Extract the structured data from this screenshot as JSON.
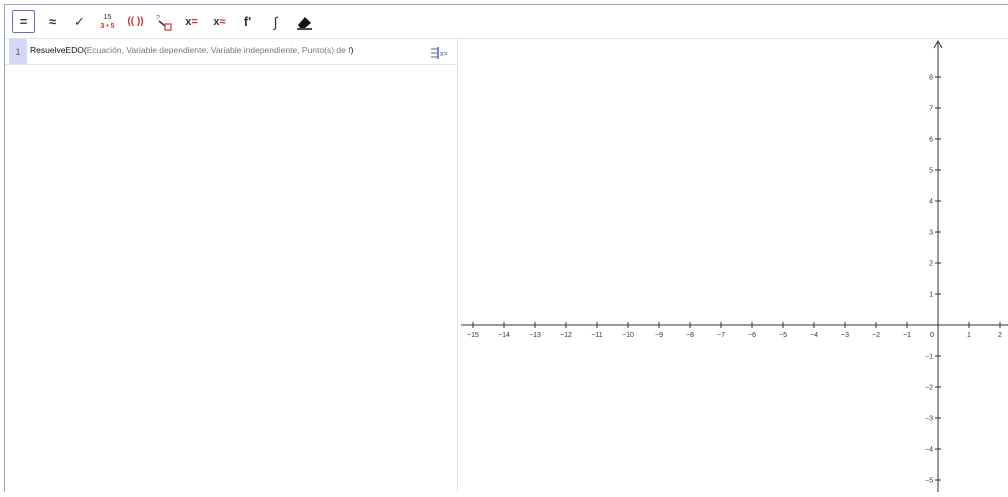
{
  "toolbar": {
    "tools": [
      {
        "name": "evaluate-tool",
        "label": "=",
        "active": true
      },
      {
        "name": "numeric-tool",
        "label": "≈"
      },
      {
        "name": "keep-input-tool",
        "label": "✓"
      },
      {
        "name": "factor-tool",
        "top": "15",
        "bottom": "3 • 5"
      },
      {
        "name": "expand-tool",
        "label": "(( ))"
      },
      {
        "name": "substitute-tool",
        "label": "?"
      },
      {
        "name": "solve-tool",
        "label": "x="
      },
      {
        "name": "solve-numeric-tool",
        "label": "x≈"
      },
      {
        "name": "derivative-tool",
        "label": "f'"
      },
      {
        "name": "integral-tool",
        "label": "∫"
      },
      {
        "name": "delete-tool",
        "label": ""
      }
    ]
  },
  "algebra": {
    "row_number": "1",
    "command_name": "ResuelveEDO(",
    "args": [
      "Ecuación",
      "Variable dependiente",
      "Variable independiente",
      "Punto(s) de f"
    ],
    "separator": ", ",
    "close": ")",
    "menu_icon": "x="
  },
  "graph": {
    "x_ticks": [
      "−15",
      "−14",
      "−13",
      "−12",
      "−11",
      "−10",
      "−9",
      "−8",
      "−7",
      "−6",
      "−5",
      "−4",
      "−3",
      "−2",
      "−1",
      "0",
      "1",
      "2"
    ],
    "y_ticks_pos": [
      "1",
      "2",
      "3",
      "4",
      "5",
      "6",
      "7",
      "8"
    ],
    "y_ticks_neg": [
      "−1",
      "−2",
      "−3",
      "−4",
      "−5"
    ],
    "x_tick_values": [
      -15,
      -14,
      -13,
      -12,
      -11,
      -10,
      -9,
      -8,
      -7,
      -6,
      -5,
      -4,
      -3,
      -2,
      -1,
      0,
      1,
      2
    ],
    "y_tick_values_pos": [
      1,
      2,
      3,
      4,
      5,
      6,
      7,
      8
    ],
    "y_tick_values_neg": [
      -1,
      -2,
      -3,
      -4,
      -5
    ]
  }
}
